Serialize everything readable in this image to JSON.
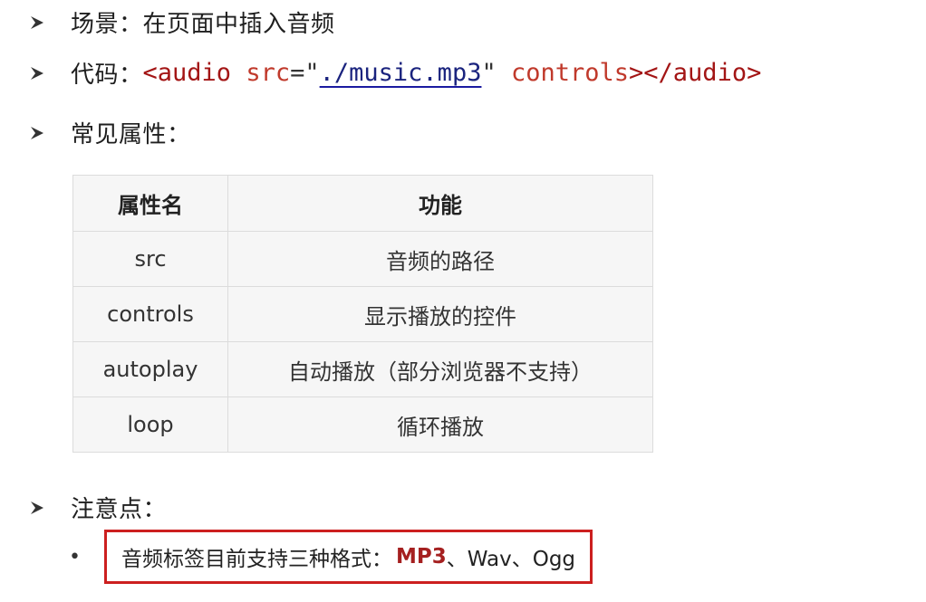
{
  "lines": {
    "scene": "场景：在页面中插入音频",
    "code_label": "代码：",
    "common_attrs": "常见属性：",
    "notes": "注意点："
  },
  "code": {
    "open_tag": "<audio",
    "attr_src": "src",
    "eq": "=",
    "quote": "\"",
    "src_value": "./music.mp3",
    "attr_controls": "controls",
    "close": "></audio>"
  },
  "table": {
    "headers": [
      "属性名",
      "功能"
    ],
    "rows": [
      [
        "src",
        "音频的路径"
      ],
      [
        "controls",
        "显示播放的控件"
      ],
      [
        "autoplay",
        "自动播放（部分浏览器不支持）"
      ],
      [
        "loop",
        "循环播放"
      ]
    ]
  },
  "note": {
    "bullet": "•",
    "prefix": "音频标签目前支持三种格式：",
    "highlight": "MP3",
    "suffix": "、Wav、Ogg"
  },
  "colors": {
    "highlight_red": "#a52020",
    "box_border": "#cc1f1f",
    "code_tag": "#a31515",
    "code_string": "#1a237e"
  }
}
